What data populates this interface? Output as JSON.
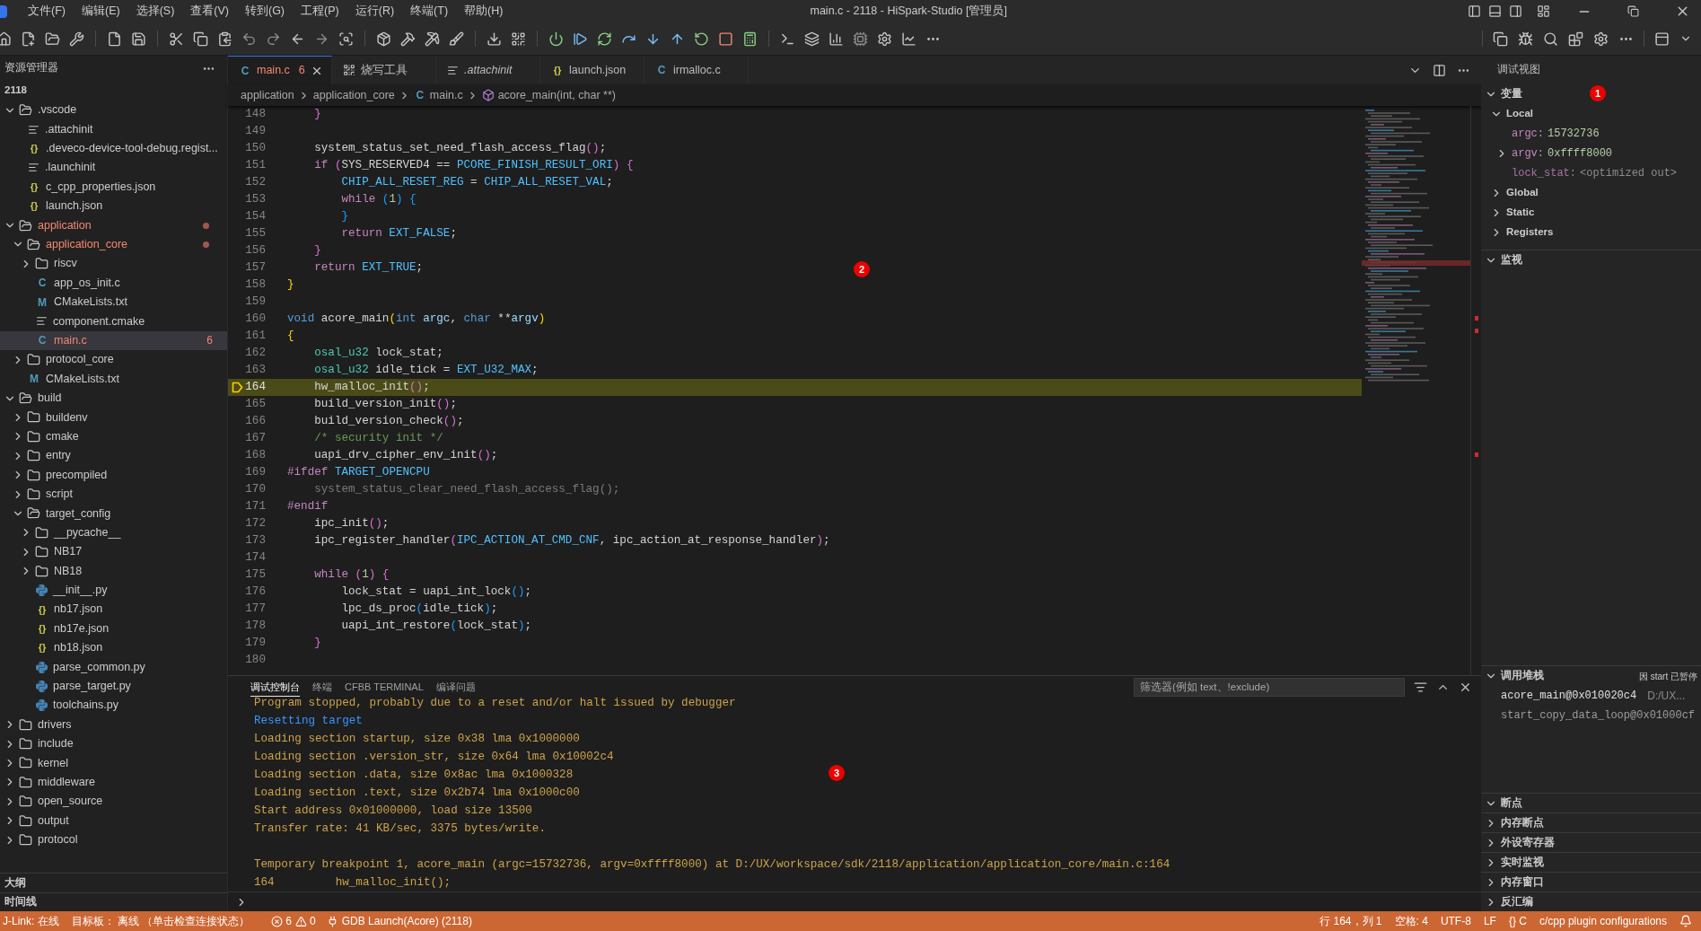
{
  "title_bar": {
    "menu": [
      "文件(F)",
      "编辑(E)",
      "选择(S)",
      "查看(V)",
      "转到(G)",
      "工程(P)",
      "运行(R)",
      "终端(T)",
      "帮助(H)"
    ],
    "title": "main.c - 2118 - HiSpark-Studio [管理员]"
  },
  "sidebar": {
    "title": "资源管理器",
    "root": "2118",
    "tree": [
      {
        "label": ".vscode",
        "kind": "folder",
        "expanded": true,
        "selected": false,
        "error": false,
        "children": [
          {
            "label": ".attachinit",
            "kind": "lines",
            "selected": false,
            "error": false
          },
          {
            "label": ".deveco-device-tool-debug.regist...",
            "kind": "json",
            "icon": "{}",
            "selected": false,
            "error": false
          },
          {
            "label": ".launchinit",
            "kind": "lines",
            "selected": false,
            "error": false
          },
          {
            "label": "c_cpp_properties.json",
            "kind": "json",
            "icon": "{}",
            "selected": false,
            "error": false
          },
          {
            "label": "launch.json",
            "kind": "json",
            "icon": "{}",
            "selected": false,
            "error": false
          }
        ]
      },
      {
        "label": "application",
        "kind": "folder",
        "expanded": true,
        "selected": false,
        "error": true,
        "children": [
          {
            "label": "application_core",
            "kind": "folder",
            "expanded": true,
            "selected": false,
            "error": true,
            "children": [
              {
                "label": "riscv",
                "kind": "folder",
                "expanded": false,
                "selected": false,
                "error": false
              },
              {
                "label": "app_os_init.c",
                "kind": "c",
                "icon": "C",
                "selected": false,
                "error": false
              },
              {
                "label": "CMakeLists.txt",
                "kind": "cmake",
                "icon": "M",
                "selected": false,
                "error": false
              },
              {
                "label": "component.cmake",
                "kind": "lines",
                "selected": false,
                "error": false
              },
              {
                "label": "main.c",
                "kind": "c",
                "icon": "C",
                "badge": "6",
                "selected": true,
                "error": true
              }
            ]
          },
          {
            "label": "protocol_core",
            "kind": "folder",
            "expanded": false,
            "selected": false,
            "error": false
          },
          {
            "label": "CMakeLists.txt",
            "kind": "cmake",
            "icon": "M",
            "selected": false,
            "error": false
          }
        ]
      },
      {
        "label": "build",
        "kind": "folder",
        "expanded": true,
        "selected": false,
        "error": false,
        "children": [
          {
            "label": "buildenv",
            "kind": "folder",
            "expanded": false,
            "selected": false,
            "error": false
          },
          {
            "label": "cmake",
            "kind": "folder",
            "expanded": false,
            "selected": false,
            "error": false
          },
          {
            "label": "entry",
            "kind": "folder",
            "expanded": false,
            "selected": false,
            "error": false
          },
          {
            "label": "precompiled",
            "kind": "folder",
            "expanded": false,
            "selected": false,
            "error": false
          },
          {
            "label": "script",
            "kind": "folder",
            "expanded": false,
            "selected": false,
            "error": false
          },
          {
            "label": "target_config",
            "kind": "folder",
            "expanded": true,
            "selected": false,
            "error": false,
            "children": [
              {
                "label": "__pycache__",
                "kind": "folder",
                "expanded": false,
                "selected": false,
                "error": false
              },
              {
                "label": "NB17",
                "kind": "folder",
                "expanded": false,
                "selected": false,
                "error": false
              },
              {
                "label": "NB18",
                "kind": "folder",
                "expanded": false,
                "selected": false,
                "error": false
              },
              {
                "label": "__init__.py",
                "kind": "python",
                "selected": false,
                "error": false
              },
              {
                "label": "nb17.json",
                "kind": "json",
                "icon": "{}",
                "selected": false,
                "error": false
              },
              {
                "label": "nb17e.json",
                "kind": "json",
                "icon": "{}",
                "selected": false,
                "error": false
              },
              {
                "label": "nb18.json",
                "kind": "json",
                "icon": "{}",
                "selected": false,
                "error": false
              },
              {
                "label": "parse_common.py",
                "kind": "python",
                "selected": false,
                "error": false
              },
              {
                "label": "parse_target.py",
                "kind": "python",
                "selected": false,
                "error": false
              },
              {
                "label": "toolchains.py",
                "kind": "python",
                "selected": false,
                "error": false
              }
            ]
          }
        ]
      },
      {
        "label": "drivers",
        "kind": "folder",
        "expanded": false,
        "selected": false,
        "error": false
      },
      {
        "label": "include",
        "kind": "folder",
        "expanded": false,
        "selected": false,
        "error": false
      },
      {
        "label": "kernel",
        "kind": "folder",
        "expanded": false,
        "selected": false,
        "error": false
      },
      {
        "label": "middleware",
        "kind": "folder",
        "expanded": false,
        "selected": false,
        "error": false
      },
      {
        "label": "open_source",
        "kind": "folder",
        "expanded": false,
        "selected": false,
        "error": false
      },
      {
        "label": "output",
        "kind": "folder",
        "expanded": false,
        "selected": false,
        "error": false
      },
      {
        "label": "protocol",
        "kind": "folder",
        "expanded": false,
        "selected": false,
        "error": false
      }
    ],
    "sections": [
      {
        "title": "大纲",
        "expanded": false
      },
      {
        "title": "时间线",
        "expanded": false
      }
    ]
  },
  "editor": {
    "tabs": [
      {
        "kind": "c",
        "icon": "C",
        "label": "main.c",
        "badge": "6",
        "selected": true,
        "error": true,
        "italic": false
      },
      {
        "kind": "tool",
        "label": "烧写工具",
        "selected": false,
        "error": false,
        "italic": false
      },
      {
        "kind": "lines",
        "label": ".attachinit",
        "selected": false,
        "error": false,
        "italic": true
      },
      {
        "kind": "json",
        "icon": "{}",
        "label": "launch.json",
        "selected": false,
        "error": false,
        "italic": false
      },
      {
        "kind": "c",
        "icon": "C",
        "label": "irmalloc.c",
        "selected": false,
        "error": false,
        "italic": false
      }
    ],
    "breadcrumb": [
      {
        "kind": "folder",
        "label": "application"
      },
      {
        "kind": "folder",
        "label": "application_core"
      },
      {
        "kind": "c",
        "icon": "C",
        "label": "main.c"
      },
      {
        "kind": "symbol",
        "label": "acore_main(int, char **)"
      }
    ],
    "marker": "2",
    "lines": [
      {
        "number": "148",
        "current": false,
        "tokens": [
          {
            "text": "    }",
            "kind": "bracket2"
          }
        ]
      },
      {
        "number": "149",
        "current": false
      },
      {
        "number": "150",
        "current": false,
        "tokens": [
          {
            "text": "    system_status_set_need_flash_access_flag",
            "kind": "plain"
          },
          {
            "text": "()",
            "kind": "bracket2"
          },
          {
            "text": ";",
            "kind": "plain"
          }
        ]
      },
      {
        "number": "151",
        "current": false,
        "tokens": [
          {
            "text": "    if",
            "kind": "keyword"
          },
          {
            "text": " (",
            "kind": "bracket2"
          },
          {
            "text": "SYS_RESERVED4 == ",
            "kind": "plain"
          },
          {
            "text": "PCORE_FINISH_RESULT_ORI",
            "kind": "macro"
          },
          {
            "text": ")",
            "kind": "bracket2"
          },
          {
            "text": " {",
            "kind": "bracket2"
          }
        ]
      },
      {
        "number": "152",
        "current": false,
        "tokens": [
          {
            "text": "        CHIP_ALL_RESET_REG",
            "kind": "macro"
          },
          {
            "text": " = ",
            "kind": "plain"
          },
          {
            "text": "CHIP_ALL_RESET_VAL",
            "kind": "macro"
          },
          {
            "text": ";",
            "kind": "plain"
          }
        ]
      },
      {
        "number": "153",
        "current": false,
        "tokens": [
          {
            "text": "        while",
            "kind": "keyword"
          },
          {
            "text": " (",
            "kind": "bracket3"
          },
          {
            "text": "1",
            "kind": "number"
          },
          {
            "text": ")",
            "kind": "bracket3"
          },
          {
            "text": " {",
            "kind": "bracket3"
          }
        ]
      },
      {
        "number": "154",
        "current": false,
        "tokens": [
          {
            "text": "        }",
            "kind": "bracket3"
          }
        ]
      },
      {
        "number": "155",
        "current": false,
        "tokens": [
          {
            "text": "        return",
            "kind": "keyword"
          },
          {
            "text": " EXT_FALSE",
            "kind": "macro"
          },
          {
            "text": ";",
            "kind": "plain"
          }
        ]
      },
      {
        "number": "156",
        "current": false,
        "tokens": [
          {
            "text": "    }",
            "kind": "bracket2"
          }
        ]
      },
      {
        "number": "157",
        "current": false,
        "tokens": [
          {
            "text": "    return",
            "kind": "keyword"
          },
          {
            "text": " EXT_TRUE",
            "kind": "macro"
          },
          {
            "text": ";",
            "kind": "plain"
          }
        ]
      },
      {
        "number": "158",
        "current": false,
        "tokens": [
          {
            "text": "}",
            "kind": "bracket1"
          }
        ]
      },
      {
        "number": "159",
        "current": false
      },
      {
        "number": "160",
        "current": false,
        "tokens": [
          {
            "text": "void",
            "kind": "type"
          },
          {
            "text": " acore_main",
            "kind": "plain"
          },
          {
            "text": "(",
            "kind": "bracket1"
          },
          {
            "text": "int",
            "kind": "type"
          },
          {
            "text": " argc",
            "kind": "variable"
          },
          {
            "text": ", ",
            "kind": "plain"
          },
          {
            "text": "char",
            "kind": "type"
          },
          {
            "text": " **",
            "kind": "plain"
          },
          {
            "text": "argv",
            "kind": "variable"
          },
          {
            "text": ")",
            "kind": "bracket1"
          }
        ]
      },
      {
        "number": "161",
        "current": false,
        "tokens": [
          {
            "text": "{",
            "kind": "bracket1"
          }
        ]
      },
      {
        "number": "162",
        "current": false,
        "tokens": [
          {
            "text": "    osal_u32",
            "kind": "typename"
          },
          {
            "text": " lock_stat;",
            "kind": "plain"
          }
        ]
      },
      {
        "number": "163",
        "current": false,
        "tokens": [
          {
            "text": "    osal_u32",
            "kind": "typename"
          },
          {
            "text": " idle_tick = ",
            "kind": "plain"
          },
          {
            "text": "EXT_U32_MAX",
            "kind": "macro"
          },
          {
            "text": ";",
            "kind": "plain"
          }
        ]
      },
      {
        "number": "164",
        "current": true,
        "tokens": [
          {
            "text": "    hw_malloc_init",
            "kind": "plain"
          },
          {
            "text": "()",
            "kind": "bracket2"
          },
          {
            "text": ";",
            "kind": "plain"
          }
        ]
      },
      {
        "number": "165",
        "current": false,
        "tokens": [
          {
            "text": "    build_version_init",
            "kind": "plain"
          },
          {
            "text": "()",
            "kind": "bracket2"
          },
          {
            "text": ";",
            "kind": "plain"
          }
        ]
      },
      {
        "number": "166",
        "current": false,
        "tokens": [
          {
            "text": "    build_version_check",
            "kind": "plain"
          },
          {
            "text": "()",
            "kind": "bracket2"
          },
          {
            "text": ";",
            "kind": "plain"
          }
        ]
      },
      {
        "number": "167",
        "current": false,
        "tokens": [
          {
            "text": "    /* security init */",
            "kind": "comment"
          }
        ]
      },
      {
        "number": "168",
        "current": false,
        "tokens": [
          {
            "text": "    uapi_drv_cipher_env_init",
            "kind": "plain"
          },
          {
            "text": "()",
            "kind": "bracket2"
          },
          {
            "text": ";",
            "kind": "plain"
          }
        ]
      },
      {
        "number": "169",
        "current": false,
        "tokens": [
          {
            "text": "#ifdef",
            "kind": "keyword"
          },
          {
            "text": " TARGET_OPENCPU",
            "kind": "macro"
          }
        ]
      },
      {
        "number": "170",
        "current": false,
        "tokens": [
          {
            "text": "    system_status_clear_need_flash_access_flag();",
            "kind": "inactive"
          }
        ]
      },
      {
        "number": "171",
        "current": false,
        "tokens": [
          {
            "text": "#endif",
            "kind": "keyword"
          }
        ]
      },
      {
        "number": "172",
        "current": false,
        "tokens": [
          {
            "text": "    ipc_init",
            "kind": "plain"
          },
          {
            "text": "()",
            "kind": "bracket2"
          },
          {
            "text": ";",
            "kind": "plain"
          }
        ]
      },
      {
        "number": "173",
        "current": false,
        "tokens": [
          {
            "text": "    ipc_register_handler",
            "kind": "plain"
          },
          {
            "text": "(",
            "kind": "bracket2"
          },
          {
            "text": "IPC_ACTION_AT_CMD_CNF",
            "kind": "macro"
          },
          {
            "text": ", ipc_action_at_response_handler",
            "kind": "plain"
          },
          {
            "text": ")",
            "kind": "bracket2"
          },
          {
            "text": ";",
            "kind": "plain"
          }
        ]
      },
      {
        "number": "174",
        "current": false
      },
      {
        "number": "175",
        "current": false,
        "tokens": [
          {
            "text": "    while",
            "kind": "keyword"
          },
          {
            "text": " (",
            "kind": "bracket2"
          },
          {
            "text": "1",
            "kind": "number"
          },
          {
            "text": ")",
            "kind": "bracket2"
          },
          {
            "text": " {",
            "kind": "bracket2"
          }
        ]
      },
      {
        "number": "176",
        "current": false,
        "tokens": [
          {
            "text": "        lock_stat = uapi_int_lock",
            "kind": "plain"
          },
          {
            "text": "()",
            "kind": "bracket3"
          },
          {
            "text": ";",
            "kind": "plain"
          }
        ]
      },
      {
        "number": "177",
        "current": false,
        "tokens": [
          {
            "text": "        lpc_ds_proc",
            "kind": "plain"
          },
          {
            "text": "(",
            "kind": "bracket3"
          },
          {
            "text": "idle_tick",
            "kind": "plain"
          },
          {
            "text": ")",
            "kind": "bracket3"
          },
          {
            "text": ";",
            "kind": "plain"
          }
        ]
      },
      {
        "number": "178",
        "current": false,
        "tokens": [
          {
            "text": "        uapi_int_restore",
            "kind": "plain"
          },
          {
            "text": "(",
            "kind": "bracket3"
          },
          {
            "text": "lock_stat",
            "kind": "plain"
          },
          {
            "text": ")",
            "kind": "bracket3"
          },
          {
            "text": ";",
            "kind": "plain"
          }
        ]
      },
      {
        "number": "179",
        "current": false,
        "tokens": [
          {
            "text": "    }",
            "kind": "bracket2"
          }
        ]
      },
      {
        "number": "180",
        "current": false
      }
    ]
  },
  "panel": {
    "tabs": [
      {
        "label": "调试控制台",
        "selected": true
      },
      {
        "label": "终端",
        "selected": false
      },
      {
        "label": "CFBB TERMINAL",
        "selected": false
      },
      {
        "label": "编译问题",
        "selected": false
      }
    ],
    "filter": {
      "placeholder": "筛选器(例如 text、!exclude)"
    },
    "marker": "3",
    "console": [
      {
        "kind": "output",
        "text": "Program stopped, probably due to a reset and/or halt issued by debugger"
      },
      {
        "kind": "info",
        "text": "Resetting target"
      },
      {
        "kind": "output",
        "text": "Loading section startup, size 0x38 lma 0x1000000"
      },
      {
        "kind": "output",
        "text": "Loading section .version_str, size 0x64 lma 0x10002c4"
      },
      {
        "kind": "output",
        "text": "Loading section .data, size 0x8ac lma 0x1000328"
      },
      {
        "kind": "output",
        "text": "Loading section .text, size 0x2b74 lma 0x1000c00"
      },
      {
        "kind": "output",
        "text": "Start address 0x01000000, load size 13500"
      },
      {
        "kind": "output",
        "text": "Transfer rate: 41 KB/sec, 3375 bytes/write."
      },
      {
        "kind": "blank"
      },
      {
        "kind": "output",
        "text": "Temporary breakpoint 1, acore_main (argc=15732736, argv=0xffff8000) at D:/UX/workspace/sdk/2118/application/application_core/main.c:164"
      },
      {
        "kind": "output",
        "text": "164         hw_malloc_init();"
      }
    ]
  },
  "debug_view": {
    "title": "调试视图",
    "marker": "1",
    "variables": {
      "title": "变量",
      "expanded": true,
      "scopes": [
        {
          "label": "Local",
          "expanded": true,
          "vars": [
            {
              "kind": "value",
              "name": "argc:",
              "value": "15732736"
            },
            {
              "kind": "object",
              "name": "argv:",
              "value": "0xffff8000",
              "expanded": false
            },
            {
              "kind": "unavailable",
              "name": "lock_stat:",
              "value": "<optimized out>"
            }
          ]
        },
        {
          "label": "Global",
          "expanded": false
        },
        {
          "label": "Static",
          "expanded": false
        },
        {
          "label": "Registers",
          "expanded": false
        }
      ]
    },
    "watch": {
      "title": "监视",
      "expanded": true
    },
    "call_stack": {
      "title": "调用堆栈",
      "expanded": true,
      "status": "因 start 已暂停",
      "frames": [
        {
          "name": "acore_main@0x010020c4",
          "source": "D:/UX...",
          "selected": true
        },
        {
          "name": "start_copy_data_loop@0x01000cf",
          "selected": false
        }
      ]
    },
    "sections": [
      {
        "title": "断点",
        "expanded": true
      },
      {
        "title": "内存断点",
        "expanded": false
      },
      {
        "title": "外设寄存器",
        "expanded": false
      },
      {
        "title": "实时监视",
        "expanded": false
      },
      {
        "title": "内存窗口",
        "expanded": false
      },
      {
        "title": "反汇编",
        "expanded": false
      }
    ]
  },
  "status_bar": {
    "left": [
      "J-Link: 在线",
      "目标板： 离线 （单击检查连接状态）"
    ],
    "errors": "6",
    "warnings": "0",
    "launch": "GDB Launch(Acore) (2118)",
    "right": [
      "行 164，列 1",
      "空格: 4",
      "UTF-8",
      "LF",
      "{} C",
      "c/cpp plugin configurations"
    ]
  }
}
